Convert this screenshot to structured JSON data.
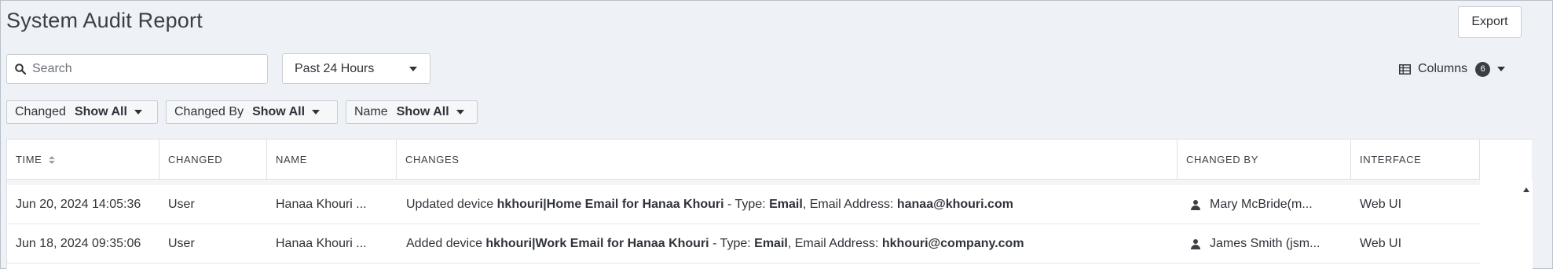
{
  "page": {
    "title": "System Audit Report",
    "export_label": "Export"
  },
  "toolbar": {
    "search_placeholder": "Search",
    "time_range": "Past 24 Hours",
    "columns_label": "Columns",
    "columns_count": "6"
  },
  "filters": [
    {
      "label": "Changed",
      "value": "Show All"
    },
    {
      "label": "Changed By",
      "value": "Show All"
    },
    {
      "label": "Name",
      "value": "Show All"
    }
  ],
  "table": {
    "columns": [
      "TIME",
      "CHANGED",
      "NAME",
      "CHANGES",
      "CHANGED BY",
      "INTERFACE"
    ],
    "rows": [
      {
        "time": "Jun 20, 2024 14:05:36",
        "changed": "User",
        "name": "Hanaa Khouri ...",
        "changes": {
          "action": "Updated device ",
          "device": "hkhouri|Home Email for Hanaa Khouri",
          "type_label": " - Type: ",
          "type": "Email",
          "addr_label": ", Email Address: ",
          "addr": "hanaa@khouri.com"
        },
        "changed_by": "Mary McBride(m...",
        "interface": "Web UI"
      },
      {
        "time": "Jun 18, 2024 09:35:06",
        "changed": "User",
        "name": "Hanaa Khouri ...",
        "changes": {
          "action": "Added device ",
          "device": "hkhouri|Work Email for Hanaa Khouri",
          "type_label": " - Type: ",
          "type": "Email",
          "addr_label": ", Email Address: ",
          "addr": "hkhouri@company.com"
        },
        "changed_by": "James Smith (jsm...",
        "interface": "Web UI"
      }
    ]
  },
  "icons": [
    "search-icon",
    "caret-down-icon",
    "grid-icon",
    "sort-icon",
    "person-icon",
    "scroll-up-icon"
  ]
}
